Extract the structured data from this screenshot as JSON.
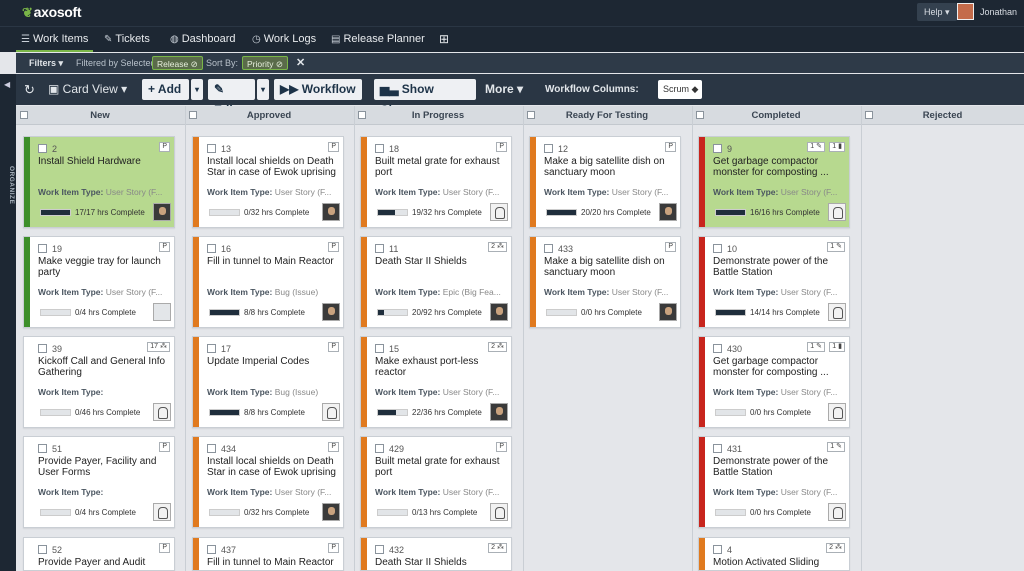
{
  "app": {
    "logo_text": "axosoft",
    "help_label": "Help ▾",
    "user_name": "Jonathan ▾"
  },
  "nav": {
    "tabs": [
      {
        "label": "Work Items",
        "icon": "list-icon"
      },
      {
        "label": "Tickets",
        "icon": "tag-icon"
      },
      {
        "label": "Dashboard",
        "icon": "dashboard-icon"
      },
      {
        "label": "Work Logs",
        "icon": "clock-icon"
      },
      {
        "label": "Release Planner",
        "icon": "release-planner-icon"
      }
    ],
    "add_tab_icon": "plus-icon"
  },
  "filterbar": {
    "filters_label": "Filters ▾",
    "filtered_by_label": "Filtered by Selected:",
    "release_chip": "Release",
    "sort_label": "Sort By:",
    "priority_chip": "Priority"
  },
  "toolbar": {
    "card_view": "Card View ▾",
    "add": "+ Add",
    "edit": "✎ Edit",
    "workflow": "▶▶ Workflow ▾",
    "show_charts": "Show Charts",
    "more": "More ▾",
    "workflow_columns_label": "Workflow Columns:",
    "workflow_columns_value": "Scrum ◆"
  },
  "sidebar": {
    "organize_label": "ORGANIZE"
  },
  "colors": {
    "green": "#3d8f2a",
    "orange": "#e07a1f",
    "red": "#c8251d",
    "highlight": "#b7d98f"
  },
  "columns": [
    {
      "name": "New",
      "cards": [
        {
          "id": "2",
          "title": "Install Shield Hardware",
          "type_label": "Work Item Type:",
          "type": "User Story (F...",
          "progress": "17/17 hrs Complete",
          "pct": 1.0,
          "badge": "P",
          "color": "green",
          "highlight": true,
          "avatar": "dark"
        },
        {
          "id": "19",
          "title": "Make veggie tray for launch party",
          "type_label": "Work Item Type:",
          "type": "User Story (F...",
          "progress": "0/4 hrs Complete",
          "pct": 0,
          "badge": "P",
          "color": "green",
          "avatar": "blank"
        },
        {
          "id": "39",
          "title": "Kickoff Call and General Info Gathering",
          "type_label": "Work Item Type:",
          "type": "",
          "progress": "0/46 hrs Complete",
          "pct": 0,
          "badge": "17 ⁂",
          "color": "",
          "avatar": "trooper"
        },
        {
          "id": "51",
          "title": "Provide Payer, Facility and User Forms",
          "type_label": "Work Item Type:",
          "type": "",
          "progress": "0/4 hrs Complete",
          "pct": 0,
          "badge": "P",
          "color": "",
          "avatar": "trooper"
        },
        {
          "id": "52",
          "title": "Provide Payer and Audit",
          "type_label": "",
          "type": "",
          "progress": "",
          "pct": 0,
          "badge": "P",
          "color": "",
          "avatar": ""
        }
      ]
    },
    {
      "name": "Approved",
      "cards": [
        {
          "id": "13",
          "title": "Install local shields on Death Star in case of Ewok uprising",
          "type_label": "Work Item Type:",
          "type": "User Story (F...",
          "progress": "0/32 hrs Complete",
          "pct": 0,
          "badge": "P",
          "color": "orange",
          "avatar": "dark"
        },
        {
          "id": "16",
          "title": "Fill in tunnel to Main Reactor",
          "type_label": "Work Item Type:",
          "type": "Bug (Issue)",
          "progress": "8/8 hrs Complete",
          "pct": 1.0,
          "badge": "P",
          "color": "orange",
          "avatar": "dark"
        },
        {
          "id": "17",
          "title": "Update Imperial Codes",
          "type_label": "Work Item Type:",
          "type": "Bug (Issue)",
          "progress": "8/8 hrs Complete",
          "pct": 1.0,
          "badge": "P",
          "color": "orange",
          "avatar": "trooper"
        },
        {
          "id": "434",
          "title": "Install local shields on Death Star in case of Ewok uprising",
          "type_label": "Work Item Type:",
          "type": "User Story (F...",
          "progress": "0/32 hrs Complete",
          "pct": 0,
          "badge": "P",
          "color": "orange",
          "avatar": "dark"
        },
        {
          "id": "437",
          "title": "Fill in tunnel to Main Reactor",
          "type_label": "",
          "type": "",
          "progress": "",
          "pct": 0,
          "badge": "P",
          "color": "orange",
          "avatar": ""
        }
      ]
    },
    {
      "name": "In Progress",
      "cards": [
        {
          "id": "18",
          "title": "Built metal grate for exhaust port",
          "type_label": "Work Item Type:",
          "type": "User Story (F...",
          "progress": "19/32 hrs Complete",
          "pct": 0.59,
          "badge": "P",
          "color": "orange",
          "avatar": "trooper"
        },
        {
          "id": "11",
          "title": "Death Star II Shields",
          "type_label": "Work Item Type:",
          "type": "Epic (Big Fea...",
          "progress": "20/92 hrs Complete",
          "pct": 0.22,
          "badge": "2 ⁂",
          "color": "orange",
          "avatar": "dark"
        },
        {
          "id": "15",
          "title": "Make exhaust port-less reactor",
          "type_label": "Work Item Type:",
          "type": "User Story (F...",
          "progress": "22/36 hrs Complete",
          "pct": 0.61,
          "badge": "2 ⁂",
          "color": "orange",
          "avatar": "dark"
        },
        {
          "id": "429",
          "title": "Built metal grate for exhaust port",
          "type_label": "Work Item Type:",
          "type": "User Story (F...",
          "progress": "0/13 hrs Complete",
          "pct": 0,
          "badge": "P",
          "color": "orange",
          "avatar": "trooper"
        },
        {
          "id": "432",
          "title": "Death Star II Shields",
          "type_label": "",
          "type": "",
          "progress": "",
          "pct": 0,
          "badge": "2 ⁂",
          "color": "orange",
          "avatar": ""
        }
      ]
    },
    {
      "name": "Ready For Testing",
      "cards": [
        {
          "id": "12",
          "title": "Make a big satellite dish on sanctuary moon",
          "type_label": "Work Item Type:",
          "type": "User Story (F...",
          "progress": "20/20 hrs Complete",
          "pct": 1.0,
          "badge": "P",
          "color": "orange",
          "avatar": "dark"
        },
        {
          "id": "433",
          "title": "Make a big satellite dish on sanctuary moon",
          "type_label": "Work Item Type:",
          "type": "User Story (F...",
          "progress": "0/0 hrs Complete",
          "pct": 0,
          "badge": "P",
          "color": "orange",
          "avatar": "dark"
        }
      ]
    },
    {
      "name": "Completed",
      "cards": [
        {
          "id": "9",
          "title": "Get garbage compactor monster for composting ...",
          "type_label": "Work Item Type:",
          "type": "User Story (F...",
          "progress": "16/16 hrs Complete",
          "pct": 1.0,
          "badge": "1 ✎",
          "badge2": "1 ▮",
          "color": "red",
          "highlight": true,
          "avatar": "trooper"
        },
        {
          "id": "10",
          "title": "Demonstrate power of the Battle Station",
          "type_label": "Work Item Type:",
          "type": "User Story (F...",
          "progress": "14/14 hrs Complete",
          "pct": 1.0,
          "badge": "1 ✎",
          "color": "red",
          "avatar": "trooper"
        },
        {
          "id": "430",
          "title": "Get garbage compactor monster for composting ...",
          "type_label": "Work Item Type:",
          "type": "User Story (F...",
          "progress": "0/0 hrs Complete",
          "pct": 0,
          "badge": "1 ✎",
          "badge2": "1 ▮",
          "color": "red",
          "avatar": "trooper"
        },
        {
          "id": "431",
          "title": "Demonstrate power of the Battle Station",
          "type_label": "Work Item Type:",
          "type": "User Story (F...",
          "progress": "0/0 hrs Complete",
          "pct": 0,
          "badge": "1 ✎",
          "color": "red",
          "avatar": "trooper"
        },
        {
          "id": "4",
          "title": "Motion Activated Sliding",
          "type_label": "",
          "type": "",
          "progress": "",
          "pct": 0,
          "badge": "2 ⁂",
          "color": "orange",
          "avatar": ""
        }
      ]
    },
    {
      "name": "Rejected",
      "cards": []
    }
  ]
}
